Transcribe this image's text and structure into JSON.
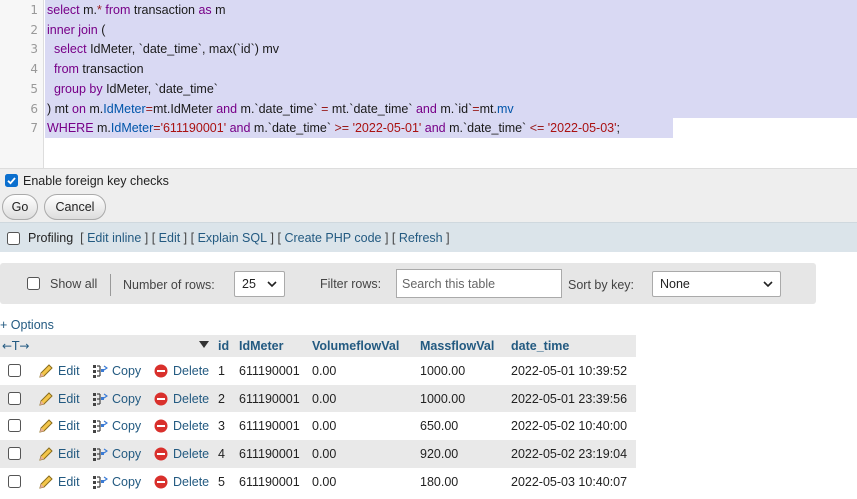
{
  "editor": {
    "line_numbers": [
      "1",
      "2",
      "3",
      "4",
      "5",
      "6",
      "7"
    ],
    "lines": [
      [
        {
          "t": "select ",
          "c": "kw"
        },
        {
          "t": "m.",
          "c": "plain"
        },
        {
          "t": "*",
          "c": "op"
        },
        {
          "t": " from ",
          "c": "kw"
        },
        {
          "t": "transaction ",
          "c": "plain"
        },
        {
          "t": "as ",
          "c": "kw"
        },
        {
          "t": "m",
          "c": "plain"
        }
      ],
      [
        {
          "t": "inner join ",
          "c": "kw"
        },
        {
          "t": "(",
          "c": "plain"
        }
      ],
      [
        {
          "t": "  select ",
          "c": "kw"
        },
        {
          "t": "IdMeter, ",
          "c": "plain"
        },
        {
          "t": "`date_time`",
          "c": "plain"
        },
        {
          "t": ", ",
          "c": "plain"
        },
        {
          "t": "max",
          "c": "plain"
        },
        {
          "t": "(`id`) ",
          "c": "plain"
        },
        {
          "t": "mv",
          "c": "plain"
        }
      ],
      [
        {
          "t": "  from ",
          "c": "kw"
        },
        {
          "t": "transaction",
          "c": "plain"
        }
      ],
      [
        {
          "t": "  group by ",
          "c": "kw"
        },
        {
          "t": "IdMeter, ",
          "c": "plain"
        },
        {
          "t": "`date_time`",
          "c": "plain"
        }
      ],
      [
        {
          "t": ") ",
          "c": "plain"
        },
        {
          "t": "mt ",
          "c": "plain"
        },
        {
          "t": "on ",
          "c": "kw"
        },
        {
          "t": "m.",
          "c": "plain"
        },
        {
          "t": "IdMeter",
          "c": "var"
        },
        {
          "t": "=",
          "c": "op"
        },
        {
          "t": "mt.",
          "c": "plain"
        },
        {
          "t": "IdMeter ",
          "c": "plain"
        },
        {
          "t": "and ",
          "c": "kw"
        },
        {
          "t": "m.`date_time` ",
          "c": "plain"
        },
        {
          "t": "= ",
          "c": "op"
        },
        {
          "t": "mt.`date_time` ",
          "c": "plain"
        },
        {
          "t": "and ",
          "c": "kw"
        },
        {
          "t": "m.`id`",
          "c": "plain"
        },
        {
          "t": "=",
          "c": "op"
        },
        {
          "t": "mt.",
          "c": "plain"
        },
        {
          "t": "mv",
          "c": "var"
        }
      ],
      [
        {
          "t": "WHERE ",
          "c": "kw"
        },
        {
          "t": "m.",
          "c": "plain"
        },
        {
          "t": "IdMeter",
          "c": "var"
        },
        {
          "t": "=",
          "c": "op"
        },
        {
          "t": "'611190001'",
          "c": "str"
        },
        {
          "t": " and ",
          "c": "kw"
        },
        {
          "t": "m.`date_time` ",
          "c": "plain"
        },
        {
          "t": ">= ",
          "c": "op"
        },
        {
          "t": "'2022-05-01'",
          "c": "str"
        },
        {
          "t": " and ",
          "c": "kw"
        },
        {
          "t": "m.`date_time` ",
          "c": "plain"
        },
        {
          "t": "<= ",
          "c": "op"
        },
        {
          "t": "'2022-05-03'",
          "c": "str"
        },
        {
          "t": ";",
          "c": "plain"
        }
      ]
    ]
  },
  "foreign_keys": {
    "label": "Enable foreign key checks",
    "checked": true
  },
  "buttons": {
    "go": "Go",
    "cancel": "Cancel"
  },
  "profiling": {
    "label": "Profiling",
    "links": [
      "Edit inline",
      "Edit",
      "Explain SQL",
      "Create PHP code",
      "Refresh"
    ]
  },
  "navigation": {
    "show_all": "Show all",
    "rows_label": "Number of rows:",
    "rows_value": "25",
    "filter_label": "Filter rows:",
    "filter_placeholder": "Search this table",
    "sort_label": "Sort by key:",
    "sort_value": "None"
  },
  "options_link": "+ Options",
  "table": {
    "sort_arrows": "←T→",
    "columns": [
      "id",
      "IdMeter",
      "VolumeflowVal",
      "MassflowVal",
      "date_time"
    ],
    "action_labels": {
      "edit": "Edit",
      "copy": "Copy",
      "delete": "Delete"
    },
    "rows": [
      [
        "1",
        "611190001",
        "0.00",
        "1000.00",
        "2022-05-01 10:39:52"
      ],
      [
        "2",
        "611190001",
        "0.00",
        "1000.00",
        "2022-05-01 23:39:56"
      ],
      [
        "3",
        "611190001",
        "0.00",
        "650.00",
        "2022-05-02 10:40:00"
      ],
      [
        "4",
        "611190001",
        "0.00",
        "920.00",
        "2022-05-02 23:19:04"
      ],
      [
        "5",
        "611190001",
        "0.00",
        "180.00",
        "2022-05-03 10:40:07"
      ]
    ]
  },
  "colors": {
    "link": "#235a81",
    "selection": "#d9d9f3",
    "keyword": "#770088",
    "string": "#aa1111",
    "delete_icon": "#d9302c"
  }
}
